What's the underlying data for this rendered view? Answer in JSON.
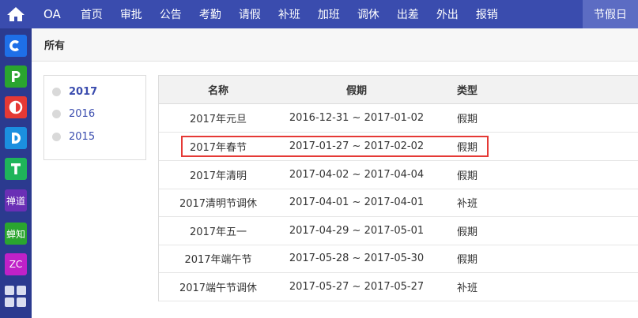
{
  "rail": {
    "apps": [
      {
        "name": "app-c",
        "glyph": "C",
        "color": "#1e6fe8"
      },
      {
        "name": "app-p",
        "glyph": "P",
        "color": "#2aa52f"
      },
      {
        "name": "app-half",
        "glyph": "",
        "color": "#e53935"
      },
      {
        "name": "app-d",
        "glyph": "D",
        "color": "#1b8fe0"
      },
      {
        "name": "app-t",
        "glyph": "T",
        "color": "#1fb45a"
      },
      {
        "name": "app-chandao",
        "glyph": "禅道",
        "color": "#6a2fb5"
      },
      {
        "name": "app-chanzhi",
        "glyph": "蝉知",
        "color": "#2aa52f"
      },
      {
        "name": "app-zc",
        "glyph": "ZC",
        "color": "#c021c8"
      }
    ]
  },
  "nav": {
    "brand": "OA",
    "items": [
      "首页",
      "审批",
      "公告",
      "考勤",
      "请假",
      "补班",
      "加班",
      "调休",
      "出差",
      "外出",
      "报销"
    ],
    "active": "节假日"
  },
  "subbar": {
    "title": "所有"
  },
  "years": [
    {
      "label": "2017",
      "selected": true
    },
    {
      "label": "2016",
      "selected": false
    },
    {
      "label": "2015",
      "selected": false
    }
  ],
  "table": {
    "headers": [
      "名称",
      "假期",
      "类型"
    ],
    "rows": [
      [
        "2017年元旦",
        "2016-12-31 ~ 2017-01-02",
        "假期"
      ],
      [
        "2017年春节",
        "2017-01-27 ~ 2017-02-02",
        "假期"
      ],
      [
        "2017年清明",
        "2017-04-02 ~ 2017-04-04",
        "假期"
      ],
      [
        "2017清明节调休",
        "2017-04-01 ~ 2017-04-01",
        "补班"
      ],
      [
        "2017年五一",
        "2017-04-29 ~ 2017-05-01",
        "假期"
      ],
      [
        "2017年端午节",
        "2017-05-28 ~ 2017-05-30",
        "假期"
      ],
      [
        "2017端午节调休",
        "2017-05-27 ~ 2017-05-27",
        "补班"
      ]
    ]
  }
}
